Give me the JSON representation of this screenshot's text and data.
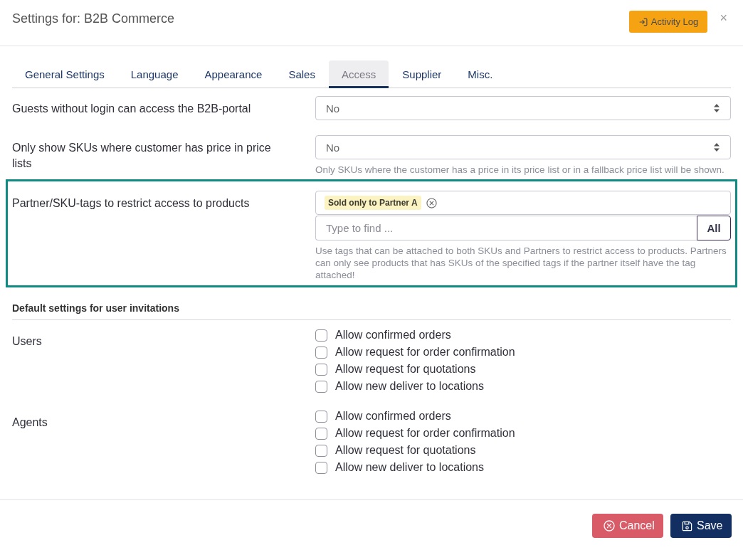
{
  "dialog": {
    "title": "Settings for: B2B Commerce",
    "activity_log_button": "Activity Log",
    "close": "×"
  },
  "tabs": [
    {
      "label": "General Settings",
      "selected": false
    },
    {
      "label": "Language",
      "selected": false
    },
    {
      "label": "Appearance",
      "selected": false
    },
    {
      "label": "Sales",
      "selected": false
    },
    {
      "label": "Access",
      "selected": true
    },
    {
      "label": "Supplier",
      "selected": false
    },
    {
      "label": "Misc.",
      "selected": false
    }
  ],
  "settings": [
    {
      "kind": "select",
      "label": "Guests without login can access the B2B-portal",
      "value": "No",
      "highlighted": false
    },
    {
      "kind": "select",
      "label": "Only show SKUs where customer has price in price lists",
      "value": "No",
      "hint": "Only SKUs where the customer has a price in its price list or in a fallback price list will be shown.",
      "highlighted": false
    },
    {
      "kind": "tags",
      "label": "Partner/SKU-tags to restrict access to products",
      "tags": [
        {
          "label": "Sold only to Partner A"
        }
      ],
      "search": {
        "placeholder": "Type to find ...",
        "button": "All"
      },
      "hint": "Use tags that can be attached to both SKUs and Partners to restrict access to products. Partners can only see products that has SKUs of the specified tags if the partner itself have the tag attached!",
      "highlighted": true
    }
  ],
  "invitation_defaults": {
    "heading": "Default settings for user invitations",
    "groups": [
      {
        "label": "Users",
        "options": [
          {
            "label": "Allow confirmed orders",
            "checked": false
          },
          {
            "label": "Allow request for order confirmation",
            "checked": false
          },
          {
            "label": "Allow request for quotations",
            "checked": false
          },
          {
            "label": "Allow new deliver to locations",
            "checked": false
          }
        ]
      },
      {
        "label": "Agents",
        "options": [
          {
            "label": "Allow confirmed orders",
            "checked": false
          },
          {
            "label": "Allow request for order confirmation",
            "checked": false
          },
          {
            "label": "Allow request for quotations",
            "checked": false
          },
          {
            "label": "Allow new deliver to locations",
            "checked": false
          }
        ]
      }
    ]
  },
  "footer": {
    "buttons": [
      {
        "kind": "cancel",
        "label": "Cancel"
      },
      {
        "kind": "save",
        "label": "Save"
      }
    ]
  }
}
